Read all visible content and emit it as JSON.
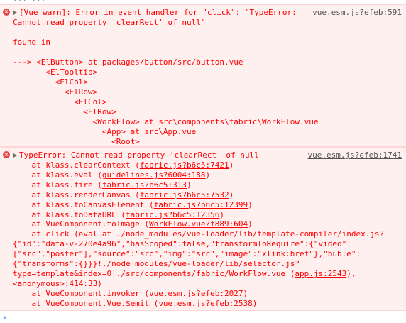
{
  "prev_line_fragment": "... ...",
  "warn": {
    "lines": [
      "[Vue warn]: Error in event handler for \"click\": \"TypeError:",
      "Cannot read property 'clearRect' of null\"",
      "",
      "found in",
      "",
      "---> <ElButton> at packages/button/src/button.vue",
      "       <ElTooltip>",
      "         <ElCol>",
      "           <ElRow>",
      "             <ElCol>",
      "               <ElRow>",
      "                 <WorkFlow> at src\\components\\fabric\\WorkFlow.vue",
      "                   <App> at src\\App.vue",
      "                     <Root>"
    ],
    "source": "vue.esm.js?efeb:591"
  },
  "error": {
    "header": "TypeError: Cannot read property 'clearRect' of null",
    "source": "vue.esm.js?efeb:1741",
    "stack": [
      {
        "pre": "    at klass.clearContext (",
        "link": "fabric.js?b6c5:7421",
        "post": ")"
      },
      {
        "pre": "    at klass.eval (",
        "link": "guidelines.js?6004:188",
        "post": ")"
      },
      {
        "pre": "    at klass.fire (",
        "link": "fabric.js?b6c5:313",
        "post": ")"
      },
      {
        "pre": "    at klass.renderCanvas (",
        "link": "fabric.js?b6c5:7532",
        "post": ")"
      },
      {
        "pre": "    at klass.toCanvasElement (",
        "link": "fabric.js?b6c5:12399",
        "post": ")"
      },
      {
        "pre": "    at klass.toDataURL (",
        "link": "fabric.js?b6c5:12356",
        "post": ")"
      },
      {
        "pre": "    at VueComponent.toImage (",
        "link": "WorkFlow.vue?f889:604",
        "post": ")"
      },
      {
        "pre": "    at click (eval at ./node_modules/vue-loader/lib/template-compiler/index.js?",
        "link": "",
        "post": ""
      },
      {
        "pre": "{\"id\":\"data-v-270e4a96\",\"hasScoped\":false,\"transformToRequire\":{\"video\":",
        "link": "",
        "post": ""
      },
      {
        "pre": "[\"src\",\"poster\"],\"source\":\"src\",\"img\":\"src\",\"image\":\"xlink:href\"},\"buble\":",
        "link": "",
        "post": ""
      },
      {
        "pre": "{\"transforms\":{}}}!./node_modules/vue-loader/lib/selector.js?",
        "link": "",
        "post": ""
      },
      {
        "pre": "type=template&index=0!./src/components/fabric/WorkFlow.vue (",
        "link": "app.js:2543",
        "post": "),"
      },
      {
        "pre": "<anonymous>:414:33)",
        "link": "",
        "post": ""
      },
      {
        "pre": "    at VueComponent.invoker (",
        "link": "vue.esm.js?efeb:2027",
        "post": ")"
      },
      {
        "pre": "    at VueComponent.Vue.$emit (",
        "link": "vue.esm.js?efeb:2538",
        "post": ")"
      }
    ]
  },
  "prompt_symbol": "›"
}
